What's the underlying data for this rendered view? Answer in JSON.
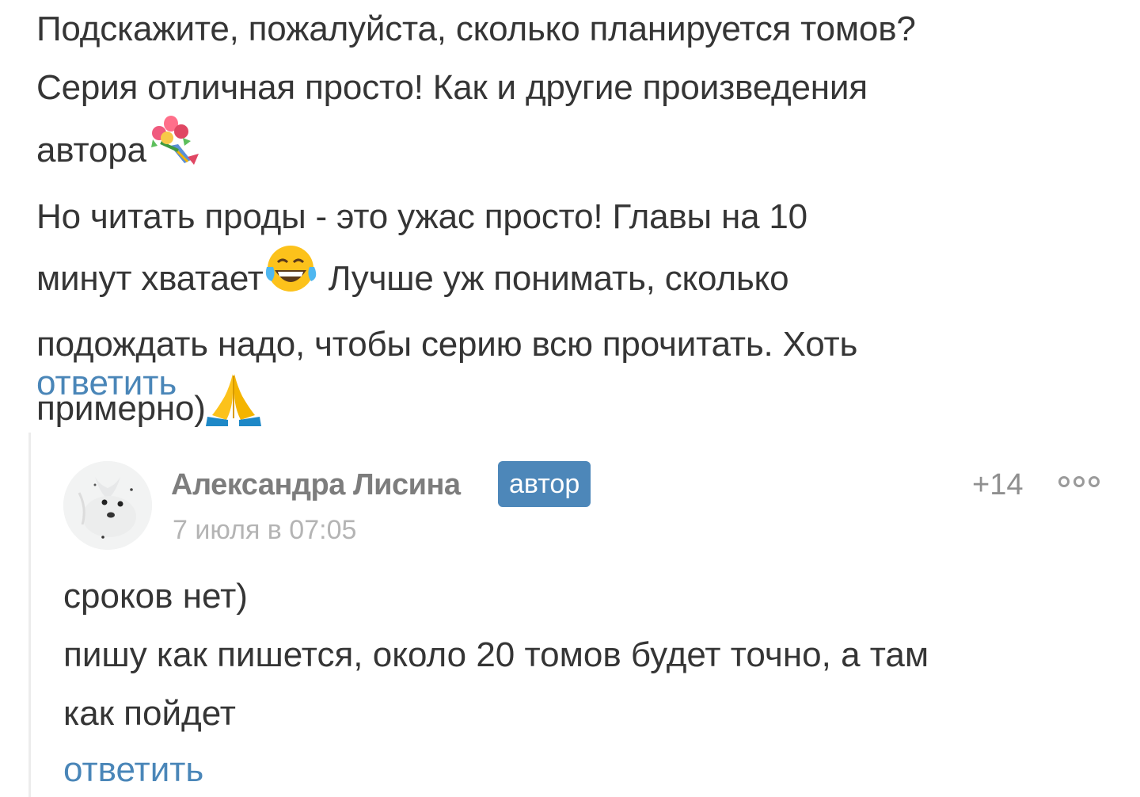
{
  "parent_comment": {
    "lines": [
      "Подскажите, пожалуйста, сколько планируется томов?",
      "Серия отличная просто! Как и другие произведения",
      "автора",
      " Но читать проды - это ужас просто! Главы на 10",
      "минут хватает",
      " Лучше уж понимать, сколько",
      "подождать надо, чтобы серию всю прочитать. Хоть",
      "примерно)"
    ],
    "emojis": [
      "bouquet-emoji",
      "tears-of-joy-emoji",
      "folded-hands-emoji"
    ],
    "reply_label": "ответить"
  },
  "child_comment": {
    "author_name": "Александра Лисина",
    "badge": "автор",
    "timestamp": "7 июля в 07:05",
    "rating": "+14",
    "lines": [
      "сроков нет)",
      "пишу как пишется, около 20 томов будет точно, а там",
      "как пойдет"
    ],
    "reply_label": "ответить"
  },
  "colors": {
    "text": "#353535",
    "link": "#4a86b8",
    "badge_bg": "#4d87b9",
    "meta": "#b4b4b4",
    "author": "#7d7d7d"
  }
}
